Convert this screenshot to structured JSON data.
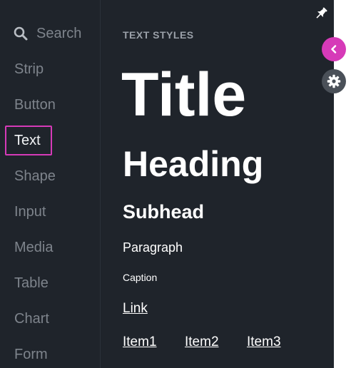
{
  "sidebar": {
    "search_label": "Search",
    "items": [
      {
        "label": "Strip"
      },
      {
        "label": "Button"
      },
      {
        "label": "Text"
      },
      {
        "label": "Shape"
      },
      {
        "label": "Input"
      },
      {
        "label": "Media"
      },
      {
        "label": "Table"
      },
      {
        "label": "Chart"
      },
      {
        "label": "Form"
      }
    ],
    "active_item": "Text"
  },
  "content": {
    "section_label": "TEXT STYLES",
    "title": "Title",
    "heading": "Heading",
    "subhead": "Subhead",
    "paragraph": "Paragraph",
    "caption": "Caption",
    "link": "Link",
    "items": [
      "Item1",
      "Item2",
      "Item3"
    ]
  },
  "icons": {
    "search": "search-icon",
    "pin": "pin-icon",
    "collapse": "chevron-left-icon",
    "settings": "gear-icon"
  },
  "colors": {
    "panel_bg": "#1f242b",
    "accent": "#d63ab8",
    "muted_text": "#7e848c",
    "settings_bg": "#4a5058"
  }
}
